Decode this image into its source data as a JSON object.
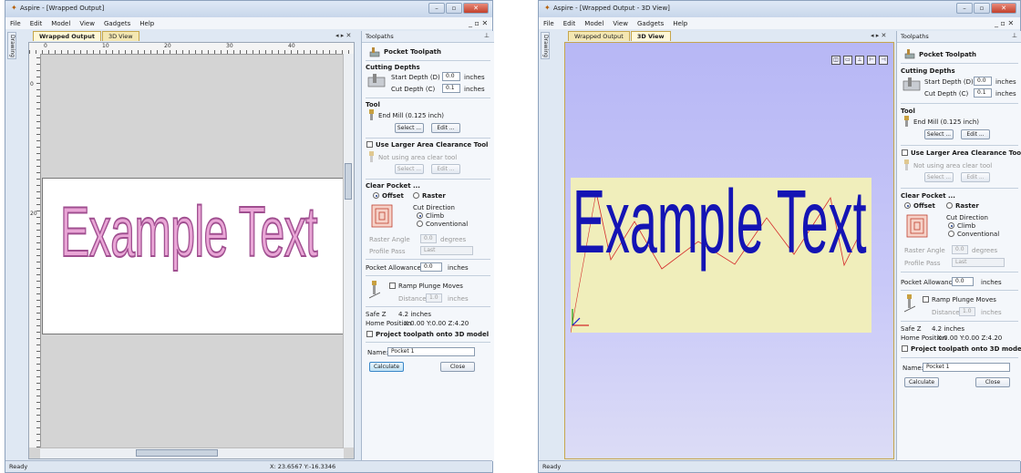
{
  "left": {
    "title": "Aspire - [Wrapped Output]",
    "menu": [
      "File",
      "Edit",
      "Model",
      "View",
      "Gadgets",
      "Help"
    ],
    "mdi_buttons": "_ ▫ ✕",
    "drawing_tab": "Drawing",
    "tabs": [
      "Wrapped Output",
      "3D View"
    ],
    "tab_arrows": "◂ ▸ ✕",
    "ruler_top": [
      "0",
      "10",
      "20",
      "30",
      "40"
    ],
    "ruler_left": [
      "0",
      "20"
    ],
    "example_text": "Example Text",
    "status_left": "Ready",
    "status_right": "X: 23.6567 Y:-16.3346"
  },
  "right": {
    "title": "Aspire - [Wrapped Output - 3D View]",
    "menu": [
      "File",
      "Edit",
      "Model",
      "View",
      "Gadgets",
      "Help"
    ],
    "mdi_buttons": "_ ▫ ✕",
    "drawing_tab": "Drawing",
    "tabs": [
      "Wrapped Output",
      "3D View"
    ],
    "tab_arrows": "◂ ▸ ✕",
    "example_text": "Example Text",
    "status_left": "Ready"
  },
  "panel": {
    "header": "Toolpaths",
    "pin": "⊥",
    "heading": "Pocket Toolpath",
    "cutting_depths": "Cutting Depths",
    "start_depth_label": "Start Depth (D)",
    "start_depth_value": "0.0",
    "cut_depth_label": "Cut Depth (C)",
    "cut_depth_value": "0.1",
    "unit": "inches",
    "tool_section": "Tool",
    "tool_name": "End Mill (0.125 inch)",
    "tool_name_b": "End Mill (0.125 inch)",
    "select_btn": "Select ...",
    "edit_btn": "Edit ...",
    "larger_tool_label": "Use Larger Area Clearance Tool",
    "not_using": "Not using area clear tool",
    "clear_pocket": "Clear Pocket ...",
    "offset_label": "Offset",
    "raster_label": "Raster",
    "cut_direction": "Cut Direction",
    "climb": "Climb",
    "conventional": "Conventional",
    "raster_angle_label": "Raster Angle",
    "raster_angle_value": "0.0",
    "degrees": "degrees",
    "profile_pass_label": "Profile Pass",
    "profile_pass_value": "Last",
    "allowance_label": "Pocket Allowance",
    "allowance_value": "0.0",
    "ramp_label": "Ramp Plunge Moves",
    "distance_label": "Distance",
    "distance_value": "1.0",
    "safe_z_label": "Safe Z",
    "safe_z_value": "4.2 inches",
    "home_label": "Home Position",
    "home_value": "X:0.00 Y:0.00 Z:4.20",
    "project_label": "Project toolpath onto 3D model",
    "name_label": "Name:",
    "name_value": "Pocket 1",
    "calculate": "Calculate",
    "close": "Close"
  },
  "colors": {
    "wrapped_text_fill": "#e9a6d6",
    "wrapped_text_stroke": "#a04f90",
    "model_text": "#1414b4",
    "toolpath_lines": "#d42a2a",
    "sky_top": "#b7b7f5",
    "sheet_plane": "#f0eebb"
  },
  "icons": {
    "app": "aspire-app-icon",
    "pocket": "pocket-toolpath-icon",
    "depth": "cutting-depth-icon",
    "endmill": "end-mill-icon",
    "offset_pattern": "offset-pattern-icon",
    "ramp": "ramp-plunge-icon"
  }
}
